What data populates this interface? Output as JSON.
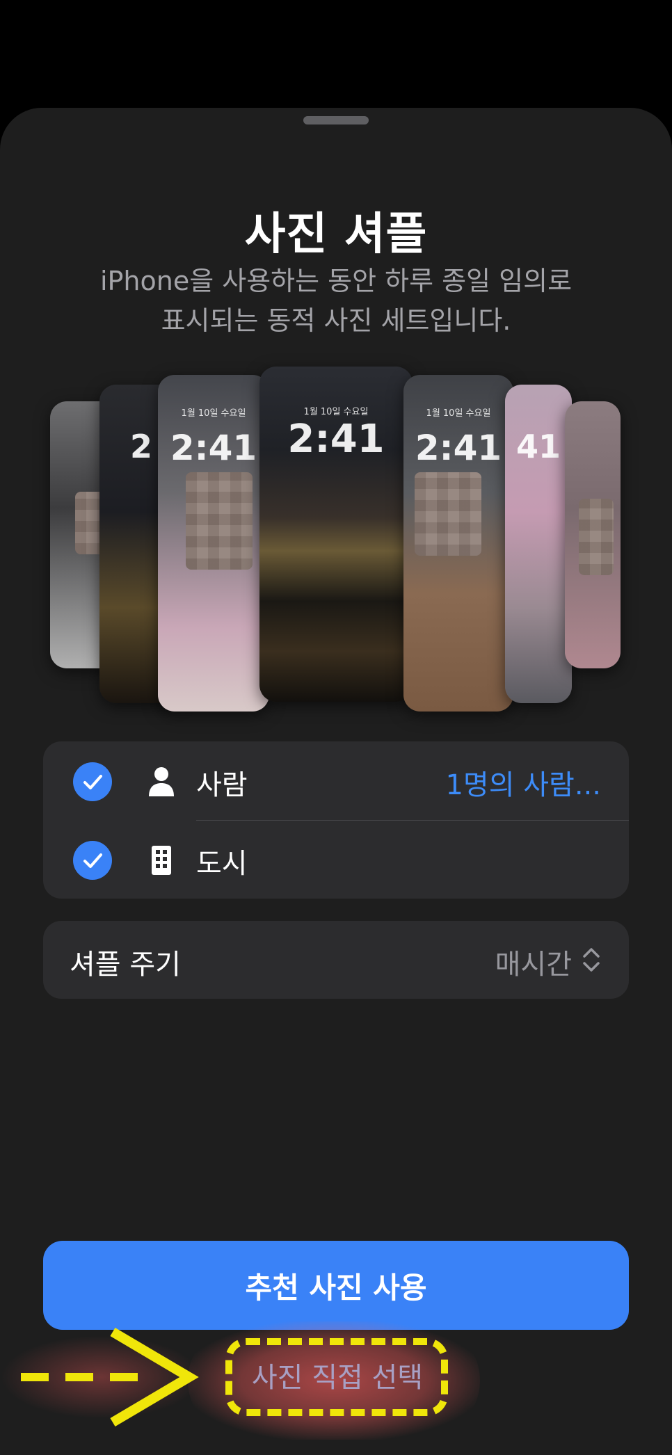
{
  "header": {
    "title": "사진 셔플",
    "subtitle_line1": "iPhone을 사용하는 동안 하루 종일 임의로",
    "subtitle_line2": "표시되는 동적 사진 세트입니다."
  },
  "carousel": {
    "center_date": "1월 10일 수요일",
    "center_time": "2:41",
    "side_date": "1월 10일 수요일",
    "side_time": "2:41"
  },
  "categories": {
    "items": [
      {
        "label": "사람",
        "icon": "person-icon",
        "checked": true,
        "value": "1명의 사람..."
      },
      {
        "label": "도시",
        "icon": "building-icon",
        "checked": true,
        "value": ""
      }
    ]
  },
  "shuffle": {
    "label": "셔플 주기",
    "value": "매시간",
    "icon": "chevron-up-down-icon"
  },
  "actions": {
    "primary_label": "추천 사진 사용",
    "secondary_label": "사진 직접 선택"
  },
  "colors": {
    "accent": "#3a82f7",
    "annotation": "#f0e60a",
    "sheet_bg": "#1e1e1e"
  }
}
